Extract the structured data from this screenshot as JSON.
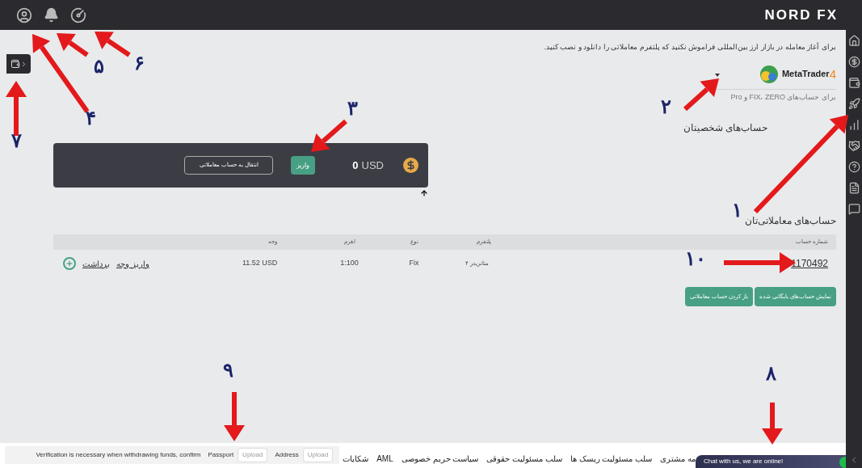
{
  "top_bar": {
    "logo": "NORD FX"
  },
  "intro": "برای آغاز معامله در بازار ارز بین‌المللی فراموش نکنید که پلتفرم معاملاتی را دانلود و نصب کنید.",
  "platform": {
    "name": "MetaTrader",
    "version": "4",
    "note": "برای حساب‌های FIX، ZERO و Pro"
  },
  "personal_heading": "حساب‌های شخصیتان",
  "wallet": {
    "amount": "0",
    "currency": "USD",
    "deposit": "واریز",
    "transfer": "انتقال به حساب معاملاتی"
  },
  "trading_heading": "حساب‌های معاملاتی‌تان",
  "table": {
    "columns": [
      "شماره حساب",
      "پلتفرم",
      "نوع",
      "اهرم",
      "وجه"
    ],
    "rows": [
      {
        "account": "1170492",
        "platform": "متاتریدر ۴",
        "type": "Fix",
        "leverage": "1:100",
        "funds": "11.52 USD",
        "actions": [
          "واریز وجه",
          "برداشت"
        ]
      }
    ]
  },
  "account_buttons": [
    "نمایش حساب‌های بایگانی شده",
    "باز کردن حساب معاملاتی"
  ],
  "verification": {
    "message": "Verification is necessary when withdrawing funds, confirm",
    "documents": [
      {
        "label": "Address",
        "button": "Upload",
        "disabled": true
      },
      {
        "label": "Passport",
        "button": "Upload",
        "disabled": true
      }
    ]
  },
  "footer_links": [
    "مه مشتری",
    "سلب مسئولیت ریسک ها",
    "سلب مسئولیت حقوقی",
    "سیاست حریم خصوصی",
    "AML",
    "شکایات"
  ],
  "chat": {
    "text": "Chat with us, we are online!"
  },
  "annotations": [
    "۱",
    "۲",
    "۳",
    "۴",
    "۵",
    "۶",
    "۷",
    "۸",
    "۹",
    "۱۰"
  ]
}
